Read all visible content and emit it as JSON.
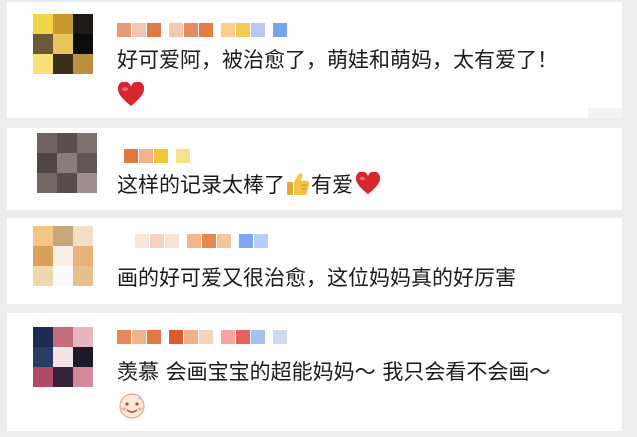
{
  "comments": [
    {
      "text": "好可爱阿，被治愈了，萌娃和萌妈，太有爱了！",
      "trailing_emoji": "heart-emoji",
      "avatar_colors": [
        "#f2d447",
        "#c79a2f",
        "#1f1a12",
        "#6a5a3a",
        "#e8c55a",
        "#0c0c0c",
        "#f5e07a",
        "#3a2e1c",
        "#b89040"
      ],
      "name_colors": [
        "#e89a75",
        "#f6c7ae",
        "#e07848",
        "#f6c7ae",
        "#ea8a60",
        "#e57a4b",
        "#f8d087",
        "#f5c858",
        "#b7cbf0",
        "#7aa3f0"
      ]
    },
    {
      "text": "这样的记录太棒了",
      "inline_emojis": [
        "thumbs-up-emoji",
        "heart-emoji"
      ],
      "text_after_thumb": "有爱",
      "avatar_colors": [
        "#6f6260",
        "#5a4f4e",
        "#7d7170",
        "#4f4544",
        "#8a7c7a",
        "#625655",
        "#726564",
        "#574c4b",
        "#9c8f8e"
      ],
      "name_colors": [
        "#e0783f",
        "#f4b28e",
        "#f3c53d",
        "#f7e08a"
      ]
    },
    {
      "text": "画的好可爱又很治愈，这位妈妈真的好厉害",
      "avatar_colors": [
        "#f5c489",
        "#c9a57a",
        "#f2e0c6",
        "#d9a15c",
        "#f7f0e4",
        "#e8b27a",
        "#f0d7b0",
        "#fafafa",
        "#e6c08f"
      ],
      "name_colors": [
        "#fbe5d8",
        "#f8d2c0",
        "#fbe0d4",
        "#f4b48c",
        "#e58a4f",
        "#f6c59b",
        "#7fa6f2",
        "#b6cdf5"
      ]
    },
    {
      "text": "羡慕 会画宝宝的超能妈妈～ 我只会看不会画～",
      "trailing_emoji": "sweat-smile-emoji",
      "avatar_colors": [
        "#1d2d4f",
        "#c36d7b",
        "#e9b6c0",
        "#293c63",
        "#f4e4e6",
        "#1a1a2a",
        "#b04a66",
        "#34223a",
        "#d38a9a"
      ],
      "name_colors": [
        "#e58a55",
        "#f0b38a",
        "#e07a45",
        "#db5a32",
        "#f3b18a",
        "#f7d2bc",
        "#f7a3a0",
        "#e7605c",
        "#a8c0f0",
        "#cddbf6"
      ]
    }
  ]
}
